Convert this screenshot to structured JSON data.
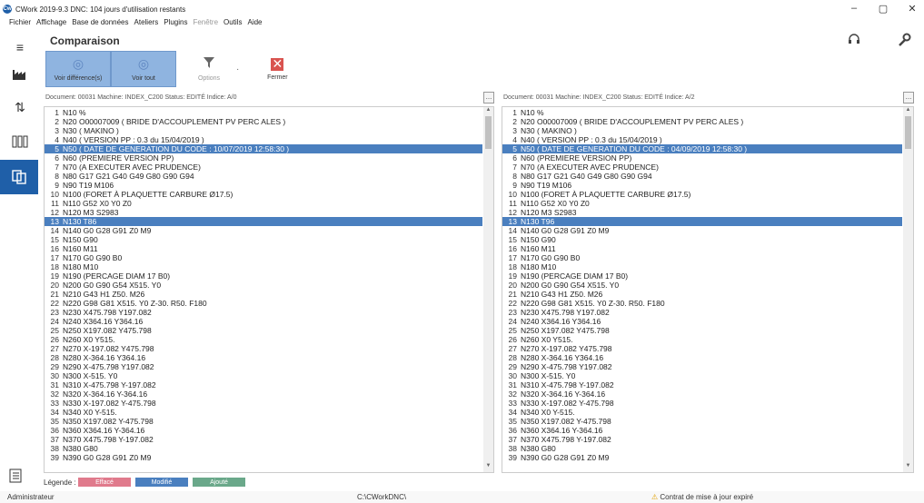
{
  "window": {
    "logo_text": "Cw",
    "title": "CWork 2019-9.3  DNC: 104 jours d'utilisation restants",
    "minimize": "–",
    "maximize": "▢",
    "close": "✕"
  },
  "menu": [
    {
      "label": "Fichier",
      "disabled": false
    },
    {
      "label": "Affichage",
      "disabled": false
    },
    {
      "label": "Base de données",
      "disabled": false
    },
    {
      "label": "Ateliers",
      "disabled": false
    },
    {
      "label": "Plugins",
      "disabled": false
    },
    {
      "label": "Fenêtre",
      "disabled": true
    },
    {
      "label": "Outils",
      "disabled": false
    },
    {
      "label": "Aide",
      "disabled": false
    }
  ],
  "sidebar_icons": [
    "hamburger-menu-icon",
    "factory-icon",
    "sort-arrows-icon",
    "binders-icon",
    "compare-documents-icon",
    "clipboard-list-icon"
  ],
  "header": {
    "title": "Comparaison"
  },
  "toolbar": {
    "show_differences": "Voir différence(s)",
    "show_all": "Voir tout",
    "options": "Options",
    "close": "Fermer"
  },
  "left_doc": {
    "info": "Document: 00031  Machine: INDEX_C200  Status: EDITÉ  Indice: A/0",
    "browse": "...",
    "lines": [
      {
        "n": "1",
        "t": "N10 %",
        "mod": false
      },
      {
        "n": "2",
        "t": "N20 O00007009 ( BRIDE D'ACCOUPLEMENT PV PERC ALES )",
        "mod": false
      },
      {
        "n": "3",
        "t": "N30 ( MAKINO )",
        "mod": false
      },
      {
        "n": "4",
        "t": "N40 ( VERSION PP : 0.3 du 15/04/2019 )",
        "mod": false
      },
      {
        "n": "5",
        "t": "N50 ( DATE DE GENERATION DU CODE : 10/07/2019 12:58:30 )",
        "mod": true
      },
      {
        "n": "6",
        "t": "N60 (PREMIERE VERSION PP)",
        "mod": false
      },
      {
        "n": "7",
        "t": "N70 (A EXECUTER AVEC PRUDENCE)",
        "mod": false
      },
      {
        "n": "8",
        "t": "N80 G17 G21 G40 G49 G80 G90 G94",
        "mod": false
      },
      {
        "n": "9",
        "t": "N90 T19 M106",
        "mod": false
      },
      {
        "n": "10",
        "t": "N100 (FORET À PLAQUETTE CARBURE Ø17.5)",
        "mod": false
      },
      {
        "n": "11",
        "t": "N110 G52 X0 Y0 Z0",
        "mod": false
      },
      {
        "n": "12",
        "t": "N120 M3 S2983",
        "mod": false
      },
      {
        "n": "13",
        "t": "N130 T86",
        "mod": true
      },
      {
        "n": "14",
        "t": "N140 G0 G28 G91 Z0 M9",
        "mod": false
      },
      {
        "n": "15",
        "t": "N150 G90",
        "mod": false
      },
      {
        "n": "16",
        "t": "N160 M11",
        "mod": false
      },
      {
        "n": "17",
        "t": "N170 G0 G90 B0",
        "mod": false
      },
      {
        "n": "18",
        "t": "N180 M10",
        "mod": false
      },
      {
        "n": "19",
        "t": "N190 (PERCAGE DIAM 17 B0)",
        "mod": false
      },
      {
        "n": "20",
        "t": "N200 G0 G90 G54 X515. Y0",
        "mod": false
      },
      {
        "n": "21",
        "t": "N210 G43 H1 Z50. M26",
        "mod": false
      },
      {
        "n": "22",
        "t": "N220 G98 G81 X515. Y0 Z-30. R50. F180",
        "mod": false
      },
      {
        "n": "23",
        "t": "N230 X475.798 Y197.082",
        "mod": false
      },
      {
        "n": "24",
        "t": "N240 X364.16 Y364.16",
        "mod": false
      },
      {
        "n": "25",
        "t": "N250 X197.082 Y475.798",
        "mod": false
      },
      {
        "n": "26",
        "t": "N260 X0 Y515.",
        "mod": false
      },
      {
        "n": "27",
        "t": "N270 X-197.082 Y475.798",
        "mod": false
      },
      {
        "n": "28",
        "t": "N280 X-364.16 Y364.16",
        "mod": false
      },
      {
        "n": "29",
        "t": "N290 X-475.798 Y197.082",
        "mod": false
      },
      {
        "n": "30",
        "t": "N300 X-515. Y0",
        "mod": false
      },
      {
        "n": "31",
        "t": "N310 X-475.798 Y-197.082",
        "mod": false
      },
      {
        "n": "32",
        "t": "N320 X-364.16 Y-364.16",
        "mod": false
      },
      {
        "n": "33",
        "t": "N330 X-197.082 Y-475.798",
        "mod": false
      },
      {
        "n": "34",
        "t": "N340 X0 Y-515.",
        "mod": false
      },
      {
        "n": "35",
        "t": "N350 X197.082 Y-475.798",
        "mod": false
      },
      {
        "n": "36",
        "t": "N360 X364.16 Y-364.16",
        "mod": false
      },
      {
        "n": "37",
        "t": "N370 X475.798 Y-197.082",
        "mod": false
      },
      {
        "n": "38",
        "t": "N380 G80",
        "mod": false
      },
      {
        "n": "39",
        "t": "N390 G0 G28 G91 Z0 M9",
        "mod": false
      }
    ]
  },
  "right_doc": {
    "info": "Document: 00031  Machine: INDEX_C200  Status: EDITÉ  Indice: A/2",
    "browse": "...",
    "lines": [
      {
        "n": "1",
        "t": "N10 %",
        "mod": false
      },
      {
        "n": "2",
        "t": "N20 O00007009 ( BRIDE D'ACCOUPLEMENT PV PERC ALES )",
        "mod": false
      },
      {
        "n": "3",
        "t": "N30 ( MAKINO )",
        "mod": false
      },
      {
        "n": "4",
        "t": "N40 ( VERSION PP : 0.3 du 15/04/2019 )",
        "mod": false
      },
      {
        "n": "5",
        "t": "N50 ( DATE DE GENERATION DU CODE : 04/09/2019 12:58:30 )",
        "mod": true
      },
      {
        "n": "6",
        "t": "N60 (PREMIERE VERSION PP)",
        "mod": false
      },
      {
        "n": "7",
        "t": "N70 (A EXECUTER AVEC PRUDENCE)",
        "mod": false
      },
      {
        "n": "8",
        "t": "N80 G17 G21 G40 G49 G80 G90 G94",
        "mod": false
      },
      {
        "n": "9",
        "t": "N90 T19 M106",
        "mod": false
      },
      {
        "n": "10",
        "t": "N100 (FORET À PLAQUETTE CARBURE Ø17.5)",
        "mod": false
      },
      {
        "n": "11",
        "t": "N110 G52 X0 Y0 Z0",
        "mod": false
      },
      {
        "n": "12",
        "t": "N120 M3 S2983",
        "mod": false
      },
      {
        "n": "13",
        "t": "N130 T96",
        "mod": true
      },
      {
        "n": "14",
        "t": "N140 G0 G28 G91 Z0 M9",
        "mod": false
      },
      {
        "n": "15",
        "t": "N150 G90",
        "mod": false
      },
      {
        "n": "16",
        "t": "N160 M11",
        "mod": false
      },
      {
        "n": "17",
        "t": "N170 G0 G90 B0",
        "mod": false
      },
      {
        "n": "18",
        "t": "N180 M10",
        "mod": false
      },
      {
        "n": "19",
        "t": "N190 (PERCAGE DIAM 17 B0)",
        "mod": false
      },
      {
        "n": "20",
        "t": "N200 G0 G90 G54 X515. Y0",
        "mod": false
      },
      {
        "n": "21",
        "t": "N210 G43 H1 Z50. M26",
        "mod": false
      },
      {
        "n": "22",
        "t": "N220 G98 G81 X515. Y0 Z-30. R50. F180",
        "mod": false
      },
      {
        "n": "23",
        "t": "N230 X475.798 Y197.082",
        "mod": false
      },
      {
        "n": "24",
        "t": "N240 X364.16 Y364.16",
        "mod": false
      },
      {
        "n": "25",
        "t": "N250 X197.082 Y475.798",
        "mod": false
      },
      {
        "n": "26",
        "t": "N260 X0 Y515.",
        "mod": false
      },
      {
        "n": "27",
        "t": "N270 X-197.082 Y475.798",
        "mod": false
      },
      {
        "n": "28",
        "t": "N280 X-364.16 Y364.16",
        "mod": false
      },
      {
        "n": "29",
        "t": "N290 X-475.798 Y197.082",
        "mod": false
      },
      {
        "n": "30",
        "t": "N300 X-515. Y0",
        "mod": false
      },
      {
        "n": "31",
        "t": "N310 X-475.798 Y-197.082",
        "mod": false
      },
      {
        "n": "32",
        "t": "N320 X-364.16 Y-364.16",
        "mod": false
      },
      {
        "n": "33",
        "t": "N330 X-197.082 Y-475.798",
        "mod": false
      },
      {
        "n": "34",
        "t": "N340 X0 Y-515.",
        "mod": false
      },
      {
        "n": "35",
        "t": "N350 X197.082 Y-475.798",
        "mod": false
      },
      {
        "n": "36",
        "t": "N360 X364.16 Y-364.16",
        "mod": false
      },
      {
        "n": "37",
        "t": "N370 X475.798 Y-197.082",
        "mod": false
      },
      {
        "n": "38",
        "t": "N380 G80",
        "mod": false
      },
      {
        "n": "39",
        "t": "N390 G0 G28 G91 Z0 M9",
        "mod": false
      }
    ]
  },
  "legend": {
    "label": "Légende :",
    "deleted": "Effacé",
    "modified": "Modifié",
    "added": "Ajouté"
  },
  "colors": {
    "modified_line": "#4a7fbf",
    "legend_deleted": "#e07a8c",
    "legend_modified": "#4a7fbf",
    "legend_added": "#6aa88a",
    "active_sidebar": "#1f5fa8"
  },
  "status": {
    "user": "Administrateur",
    "path": "C:\\CWorkDNC\\",
    "warning": "Contrat de mise à jour expiré"
  }
}
